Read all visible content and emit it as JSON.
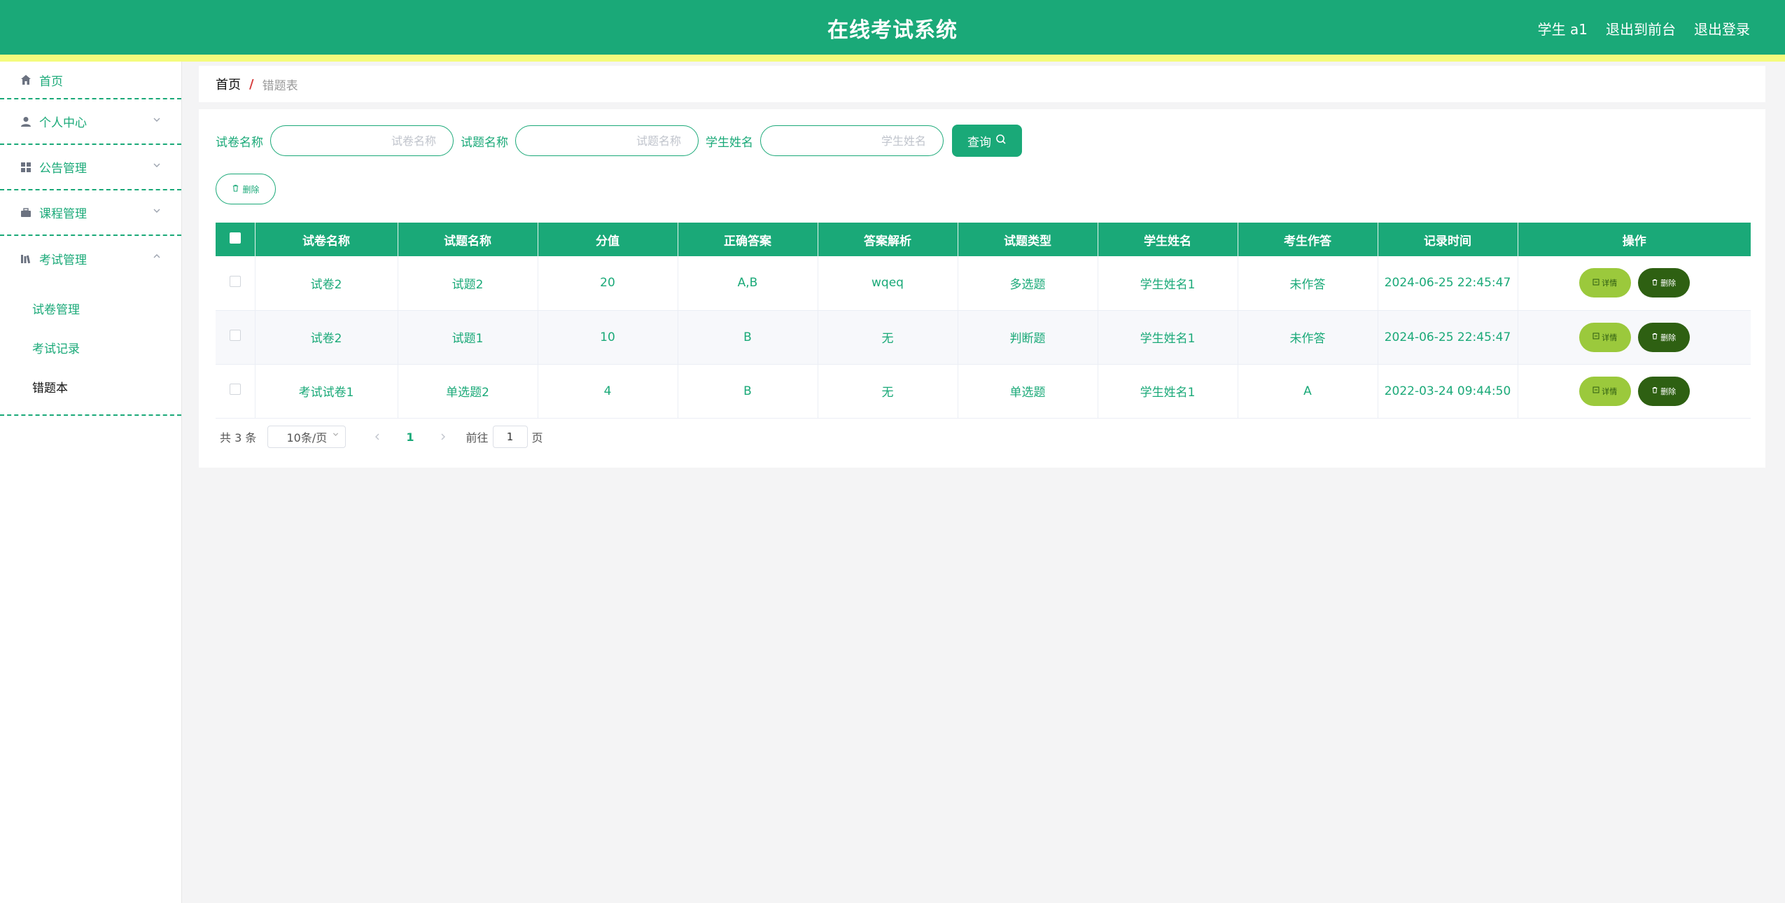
{
  "header": {
    "title": "在线考试系统",
    "user": "学生 a1",
    "to_front": "退出到前台",
    "logout": "退出登录"
  },
  "sidebar": {
    "items": [
      {
        "label": "首页",
        "icon": "home-icon"
      },
      {
        "label": "个人中心",
        "icon": "user-icon"
      },
      {
        "label": "公告管理",
        "icon": "grid-icon"
      },
      {
        "label": "课程管理",
        "icon": "briefcase-icon"
      },
      {
        "label": "考试管理",
        "icon": "library-icon"
      }
    ],
    "sub_items": [
      {
        "label": "试卷管理"
      },
      {
        "label": "考试记录"
      },
      {
        "label": "错题本"
      }
    ]
  },
  "breadcrumb": {
    "home": "首页",
    "separator": "/",
    "current": "错题表"
  },
  "search": {
    "paper_label": "试卷名称",
    "paper_placeholder": "试卷名称",
    "question_label": "试题名称",
    "question_placeholder": "试题名称",
    "student_label": "学生姓名",
    "student_placeholder": "学生姓名",
    "query_button": "查询"
  },
  "toolbar": {
    "delete_label": "删除"
  },
  "table": {
    "headers": [
      "试卷名称",
      "试题名称",
      "分值",
      "正确答案",
      "答案解析",
      "试题类型",
      "学生姓名",
      "考生作答",
      "记录时间",
      "操作"
    ],
    "rows": [
      {
        "paper": "试卷2",
        "question": "试题2",
        "score": "20",
        "answer": "A,B",
        "analysis": "wqeq",
        "type": "多选题",
        "student": "学生姓名1",
        "response": "未作答",
        "time": "2024-06-25 22:45:47"
      },
      {
        "paper": "试卷2",
        "question": "试题1",
        "score": "10",
        "answer": "B",
        "analysis": "无",
        "type": "判断题",
        "student": "学生姓名1",
        "response": "未作答",
        "time": "2024-06-25 22:45:47"
      },
      {
        "paper": "考试试卷1",
        "question": "单选题2",
        "score": "4",
        "answer": "B",
        "analysis": "无",
        "type": "单选题",
        "student": "学生姓名1",
        "response": "A",
        "time": "2022-03-24 09:44:50"
      }
    ],
    "detail_label": "详情",
    "remove_label": "删除"
  },
  "pagination": {
    "total": "共 3 条",
    "page_size": "10条/页",
    "current_page": "1",
    "goto_label": "前往",
    "goto_value": "1",
    "page_suffix": "页"
  },
  "colors": {
    "primary": "#1aa978",
    "stripe": "#f4fb7d",
    "detail_button": "#9bc93c",
    "remove_button": "#2e6012"
  }
}
